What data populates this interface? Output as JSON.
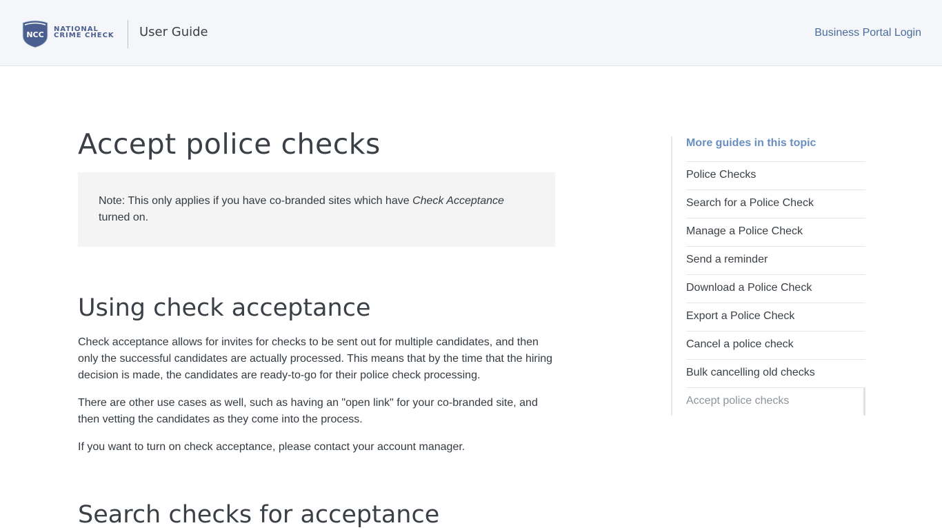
{
  "header": {
    "logo_abbr": "NCC",
    "logo_line1": "National",
    "logo_line2": "Crime Check",
    "title": "User Guide",
    "login_label": "Business Portal Login"
  },
  "main": {
    "title": "Accept police checks",
    "note_prefix": "Note: This only applies if you have co-branded sites which have ",
    "note_emph": "Check Acceptance",
    "note_suffix": " turned on.",
    "section1_heading": "Using check acceptance",
    "para1": "Check acceptance allows for invites for checks to be sent out for multiple candidates, and then only the successful candidates are actually processed. This means that by the time that the hiring decision is made, the candidates are ready-to-go for their police check processing.",
    "para2": "There are other use cases as well, such as having an \"open link\" for your co-branded site, and then vetting the candidates as they come into the process.",
    "para3": "If you want to turn on check acceptance, please contact your account manager.",
    "section2_heading": "Search checks for acceptance"
  },
  "aside": {
    "title": "More guides in this topic",
    "items": [
      {
        "label": "Police Checks"
      },
      {
        "label": "Search for a Police Check"
      },
      {
        "label": "Manage a Police Check"
      },
      {
        "label": "Send a reminder"
      },
      {
        "label": "Download a Police Check"
      },
      {
        "label": "Export a Police Check"
      },
      {
        "label": "Cancel a police check"
      },
      {
        "label": "Bulk cancelling old checks"
      },
      {
        "label": "Accept police checks"
      }
    ]
  },
  "colors": {
    "brand": "#4a5f90",
    "link": "#4a6c9c",
    "aside_title": "#6a8ec0",
    "header_bg": "#f4f6f9",
    "note_bg": "#f4f4f4"
  }
}
